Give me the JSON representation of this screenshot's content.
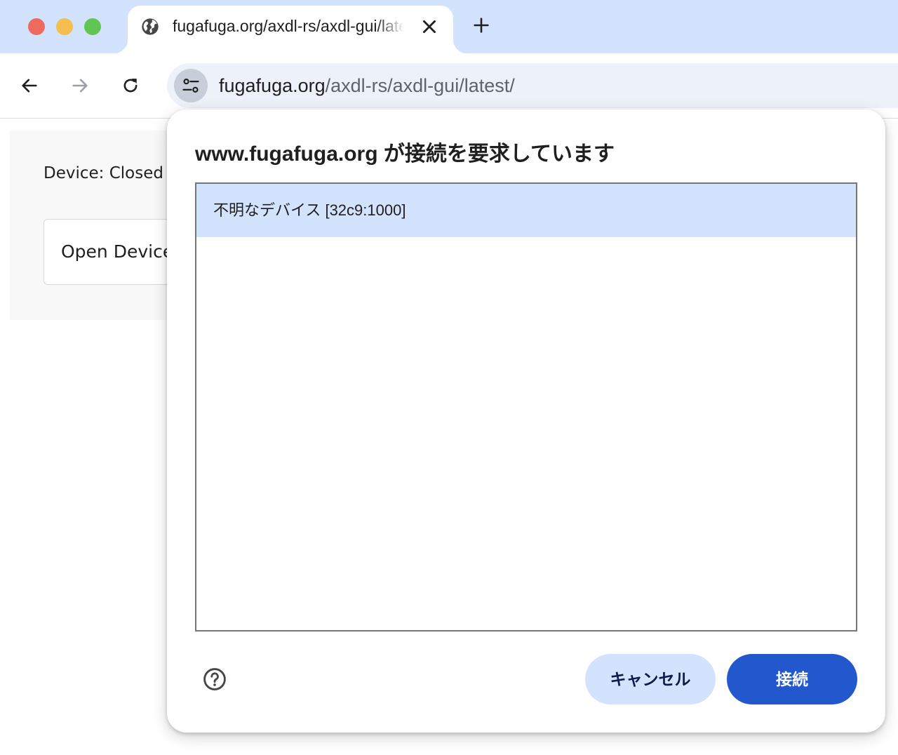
{
  "browser": {
    "tab": {
      "title": "fugafuga.org/axdl-rs/axdl-gui/latest/",
      "favicon": "globe-icon",
      "close_icon": "close-icon"
    },
    "new_tab_icon": "plus-icon",
    "toolbar": {
      "back_icon": "arrow-back-icon",
      "forward_icon": "arrow-forward-icon",
      "reload_icon": "reload-icon"
    },
    "omnibox": {
      "site_info_icon": "tune-icon",
      "domain": "fugafuga.org",
      "path": "/axdl-rs/axdl-gui/latest/"
    }
  },
  "page": {
    "device_status": "Device: Closed",
    "open_device_label": "Open Device"
  },
  "dialog": {
    "title": "www.fugafuga.org が接続を要求しています",
    "devices": [
      {
        "label": "不明なデバイス [32c9:1000]",
        "selected": true
      }
    ],
    "help_icon": "help-circle-icon",
    "cancel_label": "キャンセル",
    "connect_label": "接続"
  },
  "colors": {
    "tab_strip": "#d3e3fd",
    "omnibox": "#edf2fa",
    "selected_row": "#d3e3fd",
    "primary_button": "#2257ce",
    "tonal_button": "#d3e3fd"
  }
}
